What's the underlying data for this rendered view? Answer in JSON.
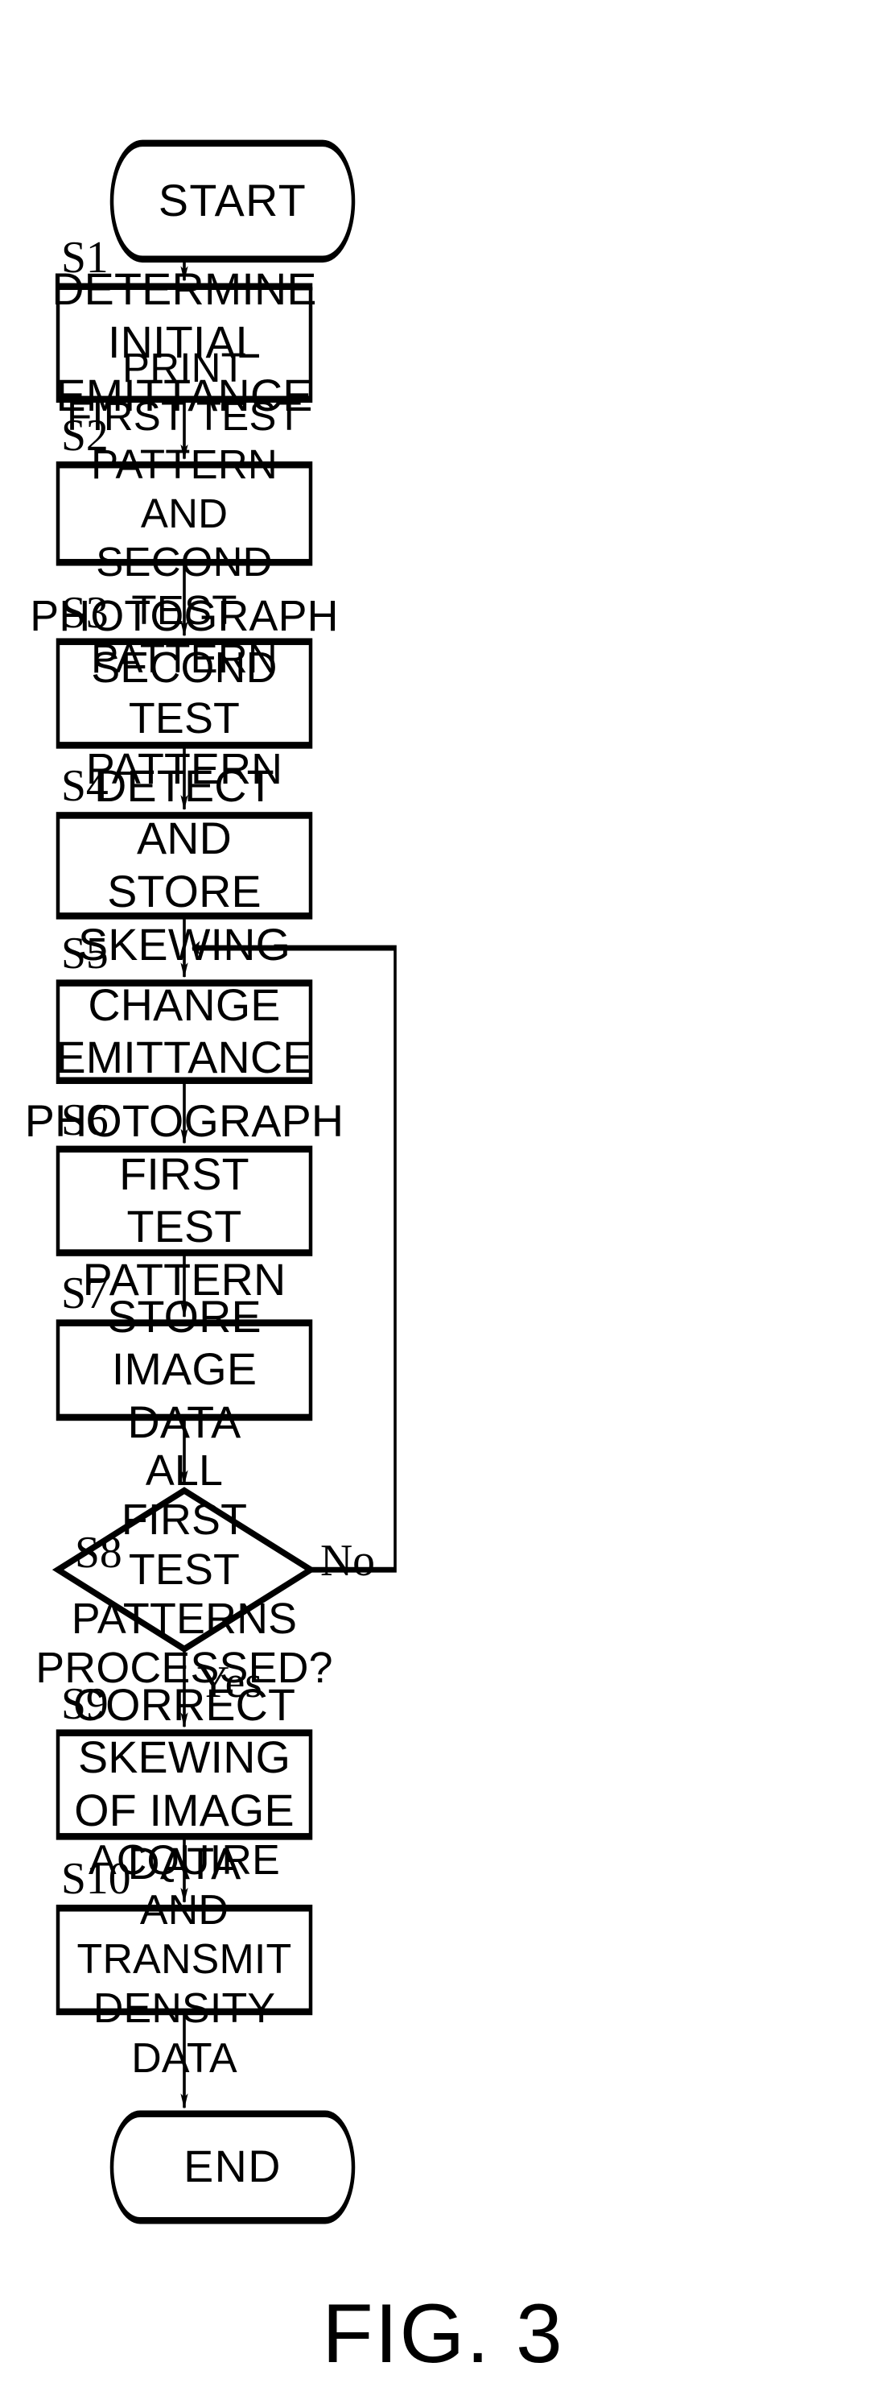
{
  "figure": {
    "caption": "FIG. 3",
    "type": "flowchart"
  },
  "nodes": {
    "start": {
      "label": "START",
      "shape": "terminator"
    },
    "s1": {
      "step": "S1",
      "line1": "DETERMINE",
      "line2": "INITIAL EMITTANCE",
      "shape": "process"
    },
    "s2": {
      "step": "S2",
      "line1": "PRINT FIRST TEST PATTERN",
      "line2": "AND SECOND TEST PATTERN",
      "shape": "process"
    },
    "s3": {
      "step": "S3",
      "line1": "PHOTOGRAPH",
      "line2": "SECOND TEST PATTERN",
      "shape": "process"
    },
    "s4": {
      "step": "S4",
      "line1": "DETECT AND",
      "line2": "STORE SKEWING",
      "shape": "process"
    },
    "s5": {
      "step": "S5",
      "line1": "CHANGE EMITTANCE",
      "line2": "",
      "shape": "process"
    },
    "s6": {
      "step": "S6",
      "line1": "PHOTOGRAPH",
      "line2": "FIRST TEST PATTERN",
      "shape": "process"
    },
    "s7": {
      "step": "S7",
      "line1": "STORE IMAGE DATA",
      "line2": "",
      "shape": "process"
    },
    "s8": {
      "step": "S8",
      "line1": "ALL FIRST",
      "line2": "TEST PATTERNS",
      "line3": "PROCESSED?",
      "shape": "decision"
    },
    "s9": {
      "step": "S9",
      "line1": "CORRECT SKEWING",
      "line2": "OF IMAGE DATA",
      "shape": "process"
    },
    "s10": {
      "step": "S10",
      "line1": "ACQUIRE AND",
      "line2": "TRANSMIT DENSITY DATA",
      "shape": "process"
    },
    "end": {
      "label": "END",
      "shape": "terminator"
    }
  },
  "edges": {
    "no_label": "No",
    "yes_label": "Yes"
  },
  "style": {
    "stroke": "#000000",
    "fill": "#ffffff",
    "background": "#ffffff"
  }
}
